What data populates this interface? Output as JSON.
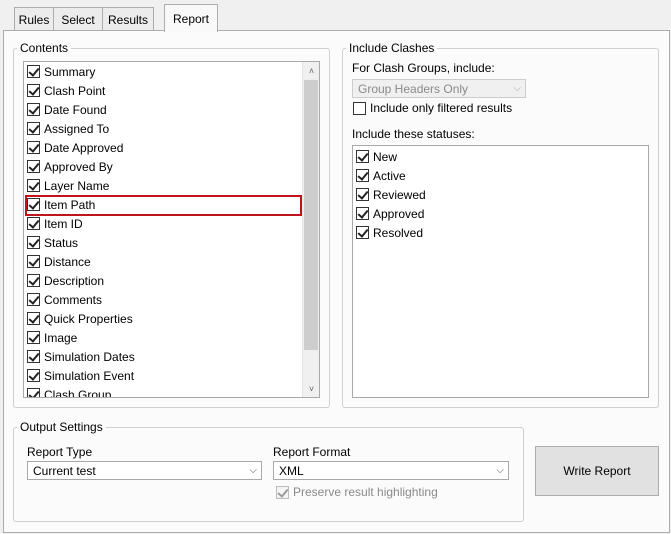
{
  "tabs": [
    "Rules",
    "Select",
    "Results",
    "Report"
  ],
  "contents": {
    "legend": "Contents",
    "items": [
      {
        "label": "Summary",
        "checked": true
      },
      {
        "label": "Clash Point",
        "checked": true
      },
      {
        "label": "Date Found",
        "checked": true
      },
      {
        "label": "Assigned To",
        "checked": true
      },
      {
        "label": "Date Approved",
        "checked": true
      },
      {
        "label": "Approved By",
        "checked": true
      },
      {
        "label": "Layer Name",
        "checked": true
      },
      {
        "label": "Item Path",
        "checked": true
      },
      {
        "label": "Item ID",
        "checked": true
      },
      {
        "label": "Status",
        "checked": true
      },
      {
        "label": "Distance",
        "checked": true
      },
      {
        "label": "Description",
        "checked": true
      },
      {
        "label": "Comments",
        "checked": true
      },
      {
        "label": "Quick Properties",
        "checked": true
      },
      {
        "label": "Image",
        "checked": true
      },
      {
        "label": "Simulation Dates",
        "checked": true
      },
      {
        "label": "Simulation Event",
        "checked": true
      },
      {
        "label": "Clash Group",
        "checked": true
      }
    ]
  },
  "include_clashes": {
    "legend": "Include Clashes",
    "groups_label": "For Clash Groups, include:",
    "groups_value": "Group Headers Only",
    "filtered_label": "Include only filtered results",
    "statuses_label": "Include these statuses:",
    "statuses": [
      {
        "label": "New",
        "checked": true
      },
      {
        "label": "Active",
        "checked": true
      },
      {
        "label": "Reviewed",
        "checked": true
      },
      {
        "label": "Approved",
        "checked": true
      },
      {
        "label": "Resolved",
        "checked": true
      }
    ]
  },
  "output": {
    "legend": "Output Settings",
    "report_type_label": "Report Type",
    "report_type_value": "Current test",
    "report_format_label": "Report Format",
    "report_format_value": "XML",
    "preserve_label": "Preserve result highlighting"
  },
  "write_report_label": "Write Report",
  "icons": {
    "dropdown": "chevron-down-icon",
    "scroll_up": "chevron-up-icon",
    "scroll_down": "chevron-down-icon"
  }
}
